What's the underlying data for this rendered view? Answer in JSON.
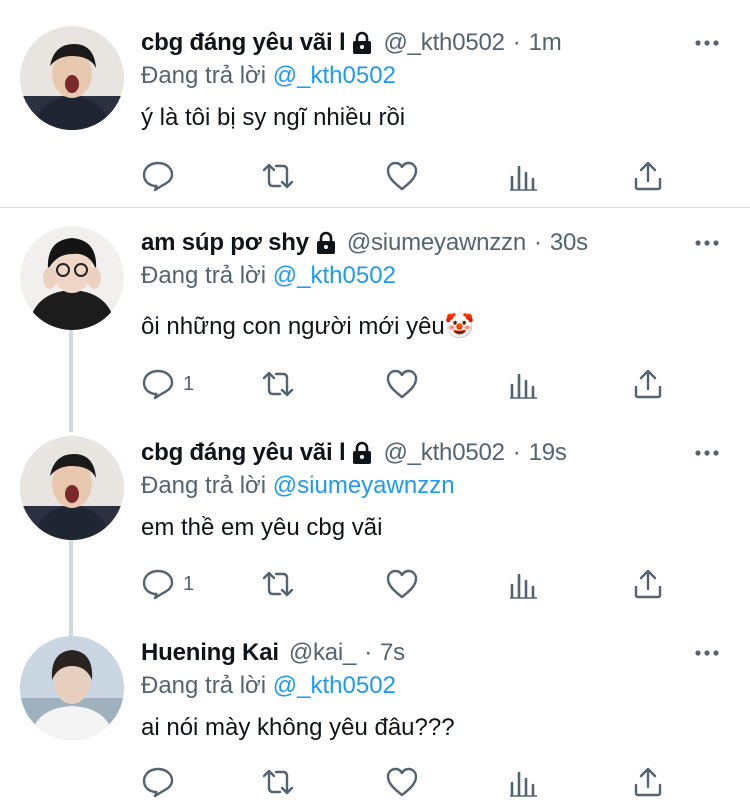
{
  "tweets": [
    {
      "name": "cbg đáng yêu vãi l",
      "locked": true,
      "handle": "@_kth0502",
      "dot": "·",
      "time": "1m",
      "replying_label": "Đang trả lời",
      "replying_to": "@_kth0502",
      "text": "ý là tôi bị sy ngĩ nhiều rồi",
      "reply_count": ""
    },
    {
      "name": "am súp pơ shy",
      "locked": true,
      "handle": "@siumeyawnzzn",
      "dot": "·",
      "time": "30s",
      "replying_label": "Đang trả lời",
      "replying_to": "@_kth0502",
      "text": "ôi những con người mới yêu🤡",
      "reply_count": "1"
    },
    {
      "name": "cbg đáng yêu vãi l",
      "locked": true,
      "handle": "@_kth0502",
      "dot": "·",
      "time": "19s",
      "replying_label": "Đang trả lời",
      "replying_to": "@siumeyawnzzn",
      "text": "em thề em yêu cbg vãi",
      "reply_count": "1"
    },
    {
      "name": "Huening Kai",
      "locked": false,
      "handle": "@kai_",
      "dot": "·",
      "time": "7s",
      "replying_label": "Đang trả lời",
      "replying_to": "@_kth0502",
      "text": "ai nói mày không yêu đâu???",
      "reply_count": ""
    }
  ],
  "colors": {
    "link": "#1d9bf0",
    "secondary_text": "#536471",
    "icon": "#536471",
    "thread_line": "#cfd9de"
  },
  "icons": [
    "reply-icon",
    "retweet-icon",
    "like-icon",
    "views-icon",
    "share-icon",
    "more-icon",
    "lock-icon"
  ]
}
